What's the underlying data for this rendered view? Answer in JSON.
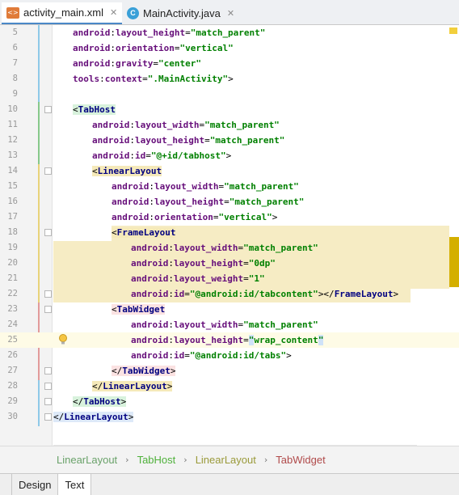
{
  "tabs": [
    {
      "label": "activity_main.xml",
      "icon": "xml-file-icon",
      "active": true
    },
    {
      "label": "MainActivity.java",
      "icon": "java-class-icon",
      "active": false
    }
  ],
  "editor": {
    "lines": [
      {
        "n": "5"
      },
      {
        "n": "6"
      },
      {
        "n": "7"
      },
      {
        "n": "8"
      },
      {
        "n": "9"
      },
      {
        "n": "10"
      },
      {
        "n": "11"
      },
      {
        "n": "12"
      },
      {
        "n": "13"
      },
      {
        "n": "14"
      },
      {
        "n": "15"
      },
      {
        "n": "16"
      },
      {
        "n": "17"
      },
      {
        "n": "18"
      },
      {
        "n": "19"
      },
      {
        "n": "20"
      },
      {
        "n": "21"
      },
      {
        "n": "22"
      },
      {
        "n": "23"
      },
      {
        "n": "24"
      },
      {
        "n": "25"
      },
      {
        "n": "26"
      },
      {
        "n": "27"
      },
      {
        "n": "28"
      },
      {
        "n": "29"
      },
      {
        "n": "30"
      }
    ],
    "tokens": {
      "android": "android",
      "tools": "tools",
      "layout_height": "layout_height",
      "layout_width": "layout_width",
      "layout_weight": "layout_weight",
      "orientation": "orientation",
      "gravity": "gravity",
      "context": "context",
      "id": "id",
      "match_parent": "\"match_parent\"",
      "vertical": "\"vertical\"",
      "center": "\"center\"",
      "main_activity": "\".MainActivity\"",
      "tabhost_id": "\"@+id/tabhost\"",
      "zero_dp": "\"0dp\"",
      "one": "\"1\"",
      "tabcontent_id": "\"@android:id/tabcontent\"",
      "wrap_content_open": "\"",
      "wrap_content": "wrap_content",
      "wrap_content_close": "\"",
      "tabs_id": "\"@android:id/tabs\"",
      "TabHost": "TabHost",
      "LinearLayout": "LinearLayout",
      "FrameLayout": "FrameLayout",
      "TabWidget": "TabWidget"
    }
  },
  "breadcrumb": [
    "LinearLayout",
    "TabHost",
    "LinearLayout",
    "TabWidget"
  ],
  "breadcrumb_separator": "›",
  "view_tabs": [
    {
      "label": "Design",
      "active": false
    },
    {
      "label": "Text",
      "active": true
    }
  ],
  "colors": {
    "tag": "#000080",
    "attribute": "#660e7a",
    "value": "#008000",
    "highlight_band": "#f6ecc4",
    "caret_line": "#fefbe6",
    "scroll_marker": "#d4af00"
  }
}
